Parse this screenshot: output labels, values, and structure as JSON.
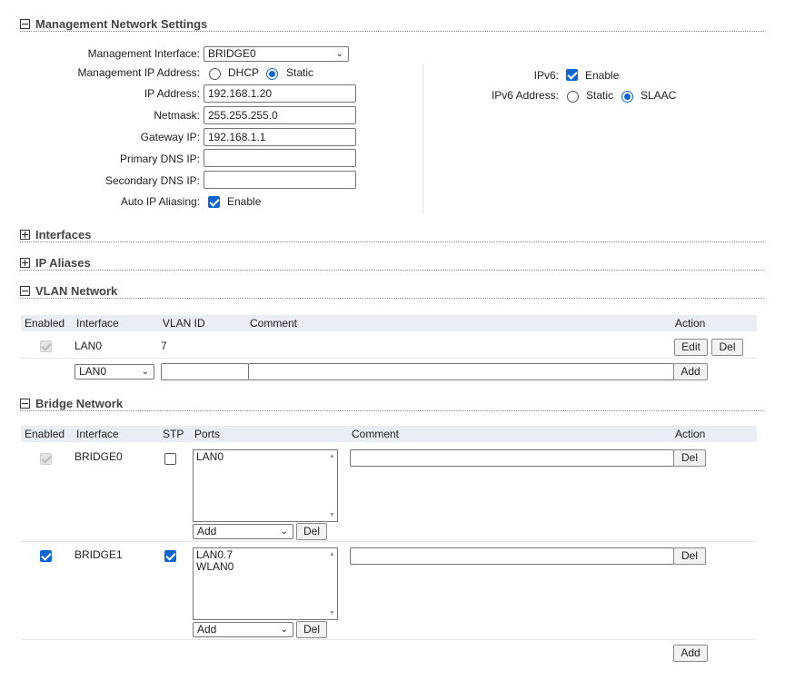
{
  "management": {
    "title": "Management Network Settings",
    "interface_label": "Management Interface:",
    "interface_value": "BRIDGE0",
    "ip_mode_label": "Management IP Address:",
    "ip_mode_dhcp": "DHCP",
    "ip_mode_static": "Static",
    "ip_label": "IP Address:",
    "ip_value": "192.168.1.20",
    "netmask_label": "Netmask:",
    "netmask_value": "255.255.255.0",
    "gateway_label": "Gateway IP:",
    "gateway_value": "192.168.1.1",
    "dns1_label": "Primary DNS IP:",
    "dns1_value": "",
    "dns2_label": "Secondary DNS IP:",
    "dns2_value": "",
    "aliasing_label": "Auto IP Aliasing:",
    "aliasing_option": "Enable",
    "ipv6_label": "IPv6:",
    "ipv6_option": "Enable",
    "ipv6_addr_label": "IPv6 Address:",
    "ipv6_static": "Static",
    "ipv6_slaac": "SLAAC"
  },
  "interfaces": {
    "title": "Interfaces"
  },
  "ip_aliases": {
    "title": "IP Aliases"
  },
  "vlan": {
    "title": "VLAN Network",
    "headers": {
      "enabled": "Enabled",
      "interface": "Interface",
      "vlan_id": "VLAN ID",
      "comment": "Comment",
      "action": "Action"
    },
    "rows": [
      {
        "interface": "LAN0",
        "vlan_id": "7",
        "comment": ""
      }
    ],
    "new_row": {
      "interface": "LAN0",
      "vlan_id": "",
      "comment": ""
    },
    "edit_label": "Edit",
    "del_label": "Del",
    "add_label": "Add"
  },
  "bridge": {
    "title": "Bridge Network",
    "headers": {
      "enabled": "Enabled",
      "interface": "Interface",
      "stp": "STP",
      "ports": "Ports",
      "comment": "Comment",
      "action": "Action"
    },
    "rows": [
      {
        "interface": "BRIDGE0",
        "ports": [
          "LAN0"
        ],
        "add_select": "Add",
        "port_del": "Del",
        "comment": "",
        "del": "Del"
      },
      {
        "interface": "BRIDGE1",
        "ports": [
          "LAN0.7",
          "WLAN0"
        ],
        "add_select": "Add",
        "port_del": "Del",
        "comment": "",
        "del": "Del"
      }
    ],
    "add_label": "Add"
  }
}
